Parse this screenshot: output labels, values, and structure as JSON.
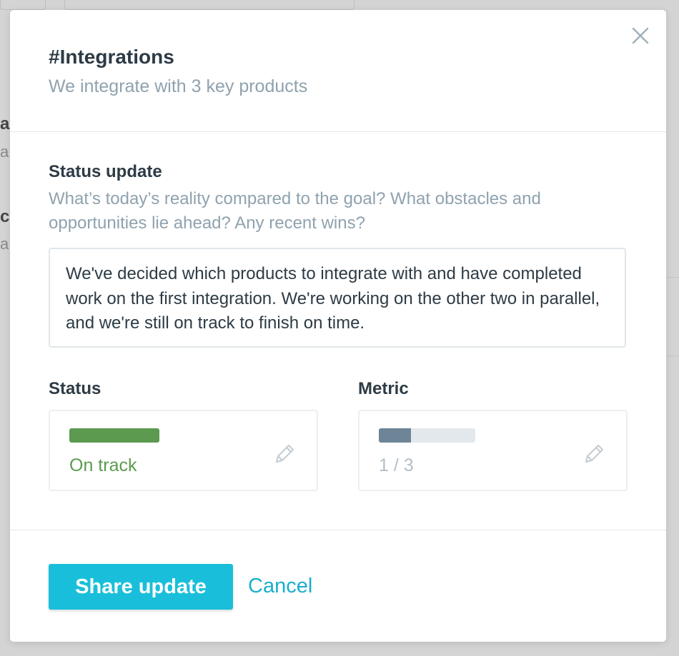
{
  "background": {
    "fragments": [
      "a",
      "a",
      "c",
      "a"
    ]
  },
  "modal": {
    "title": "#Integrations",
    "subtitle": "We integrate with 3 key products",
    "status_update": {
      "label": "Status update",
      "help": "What’s today’s reality compared to the goal? What obstacles and opportunities lie ahead? Any recent wins?",
      "text": "We've decided which products to integrate with and have completed work on the first integration. We're working on the other two in parallel, and we're still on track to finish on time."
    },
    "status": {
      "label": "Status",
      "value": "On track",
      "color": "#5b9a4f"
    },
    "metric": {
      "label": "Metric",
      "value": "1 / 3",
      "current": 1,
      "target": 3
    },
    "buttons": {
      "share": "Share update",
      "cancel": "Cancel"
    },
    "icons": {
      "close": "close-icon",
      "edit": "pencil-icon"
    },
    "colors": {
      "accent": "#19bfda",
      "link": "#1aaecd",
      "on_track": "#5b9a4f",
      "metric_fill": "#6d8596"
    }
  }
}
